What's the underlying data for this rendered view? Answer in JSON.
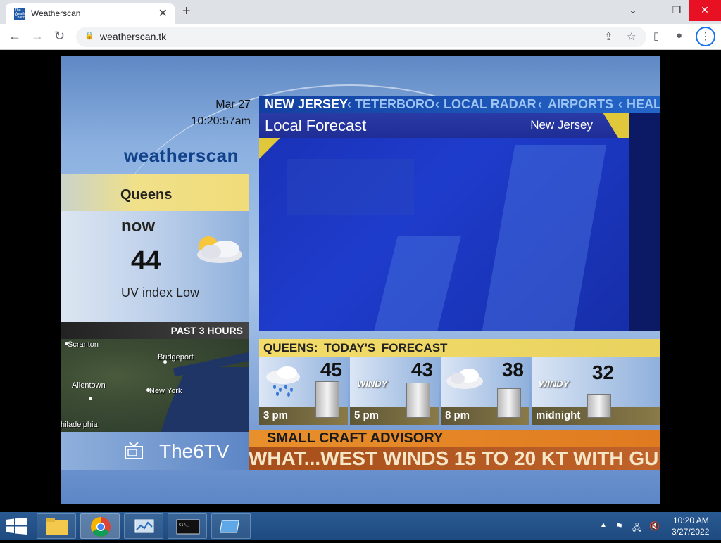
{
  "browser": {
    "tab_title": "Weatherscan",
    "tab_favicon_text": "The Weather Channel",
    "url": "weatherscan.tk",
    "win_controls": {
      "minimize": "⌄",
      "restore": "❐",
      "close": "✕"
    }
  },
  "weatherscan": {
    "date": "Mar 27",
    "time": "10:20:57am",
    "logo": "weatherscan",
    "city": "Queens",
    "now_label": "now",
    "now_temp": "44",
    "uv": "UV index Low",
    "now_icon": "partly-cloudy-icon",
    "past_label": "PAST 3 HOURS",
    "map_labels": [
      "Scranton",
      "Bridgeport",
      "Allentown",
      "New York",
      "hiladelphia"
    ],
    "brand": "The6TV",
    "breadcrumbs": {
      "active": "NEW JERSEY",
      "items": [
        "TETERBORO",
        "LOCAL RADAR",
        "AIRPORTS",
        "HEAL"
      ]
    },
    "panel_title": "Local Forecast",
    "panel_region": "New Jersey",
    "forecast": {
      "title": "QUEENS:   TODAY'S FORECAST",
      "slots": [
        {
          "time": "3 pm",
          "temp": "45",
          "condition": "rain-cloud-icon",
          "label": ""
        },
        {
          "time": "5 pm",
          "temp": "43",
          "condition": "windy-icon",
          "label": "WINDY"
        },
        {
          "time": "8 pm",
          "temp": "38",
          "condition": "cloud-icon",
          "label": ""
        },
        {
          "time": "midnight",
          "temp": "32",
          "condition": "windy-icon",
          "label": "WINDY"
        }
      ]
    },
    "advisory": {
      "title": "SMALL CRAFT ADVISORY",
      "text": "WHAT...WEST WINDS 15 TO 20 KT WITH GU"
    }
  },
  "taskbar": {
    "time": "10:20 AM",
    "date": "3/27/2022"
  }
}
